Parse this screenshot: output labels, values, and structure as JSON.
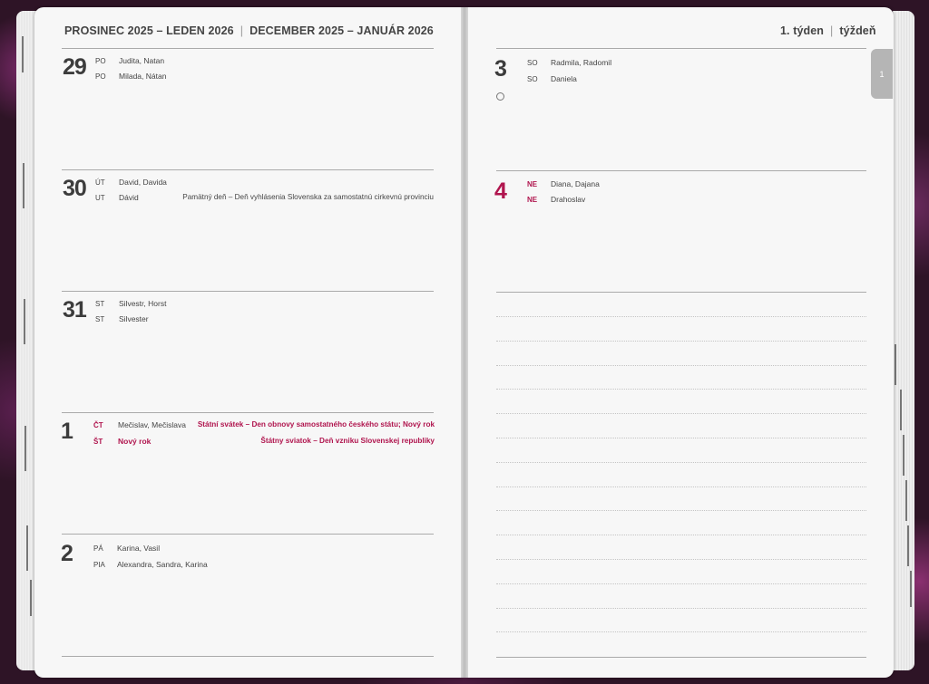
{
  "header_left": {
    "cz": "PROSINEC 2025 – LEDEN 2026",
    "separator": "|",
    "sk": "DECEMBER 2025 – JANUÁR 2026"
  },
  "header_right": {
    "cz": "1. týden",
    "separator": "|",
    "sk": "týždeň"
  },
  "week_tab": "1",
  "days": [
    {
      "num": "29",
      "cz_abbr": "PO",
      "cz_name": "Judita, Natan",
      "sk_abbr": "PO",
      "sk_name": "Milada, Nátan",
      "cz_note": "",
      "sk_note": ""
    },
    {
      "num": "30",
      "cz_abbr": "ÚT",
      "cz_name": "David, Davida",
      "sk_abbr": "UT",
      "sk_name": "Dávid",
      "cz_note": "",
      "sk_note": "Pamätný deň – Deň vyhlásenia Slovenska za samostatnú cirkevnú provinciu"
    },
    {
      "num": "31",
      "cz_abbr": "ST",
      "cz_name": "Silvestr, Horst",
      "sk_abbr": "ST",
      "sk_name": "Silvester",
      "cz_note": "",
      "sk_note": ""
    },
    {
      "num": "1",
      "cz_abbr": "ČT",
      "cz_name": "Mečislav, Mečislava",
      "sk_abbr": "ŠT",
      "sk_name": "Nový rok",
      "cz_note": "Státní svátek – Den obnovy samostatného českého státu; Nový rok",
      "sk_note": "Štátny sviatok – Deň vzniku Slovenskej republiky"
    },
    {
      "num": "2",
      "cz_abbr": "PÁ",
      "cz_name": "Karina, Vasil",
      "sk_abbr": "PIA",
      "sk_name": "Alexandra, Sandra, Karina",
      "cz_note": "",
      "sk_note": ""
    },
    {
      "num": "3",
      "cz_abbr": "SO",
      "cz_name": "Radmila, Radomil",
      "sk_abbr": "SO",
      "sk_name": "Daniela",
      "cz_note": "",
      "sk_note": ""
    },
    {
      "num": "4",
      "cz_abbr": "NE",
      "cz_name": "Diana, Dajana",
      "sk_abbr": "NE",
      "sk_name": "Drahoslav",
      "cz_note": "",
      "sk_note": ""
    }
  ],
  "colors": {
    "accent": "#b0154e",
    "text": "#444444",
    "page": "#f7f7f7"
  },
  "icons": {
    "moon_phase": "full-moon-icon"
  }
}
